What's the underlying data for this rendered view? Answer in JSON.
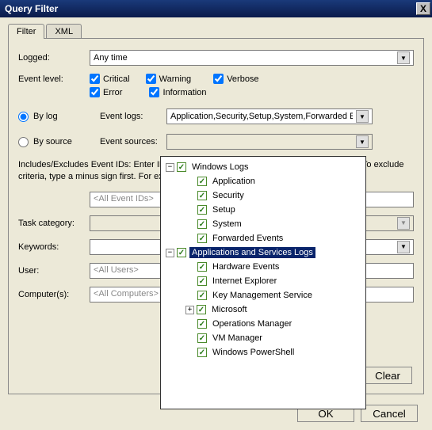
{
  "window": {
    "title": "Query Filter",
    "close": "X"
  },
  "tabs": {
    "filter": "Filter",
    "xml": "XML"
  },
  "labels": {
    "logged": "Logged:",
    "eventLevel": "Event level:",
    "byLog": "By log",
    "bySource": "By source",
    "eventLogs": "Event logs:",
    "eventSources": "Event sources:",
    "desc": "Includes/Excludes Event IDs: Enter ID numbers and/or ID ranges separated by commas. To exclude criteria, type a minus sign first. For example 1,3,5-99,-76",
    "taskCategory": "Task category:",
    "keywords": "Keywords:",
    "user": "User:",
    "computers": "Computer(s):"
  },
  "values": {
    "logged": "Any time",
    "eventLogs": "Application,Security,Setup,System,Forwarded Events",
    "eventSources": "",
    "eventIds": "<All Event IDs>",
    "users": "<All Users>",
    "computers": "<All Computers>"
  },
  "levels": {
    "critical": "Critical",
    "warning": "Warning",
    "verbose": "Verbose",
    "error": "Error",
    "information": "Information"
  },
  "buttons": {
    "clear": "Clear",
    "ok": "OK",
    "cancel": "Cancel"
  },
  "tree": {
    "root1": "Windows Logs",
    "r1c": [
      "Application",
      "Security",
      "Setup",
      "System",
      "Forwarded Events"
    ],
    "root2": "Applications and Services Logs",
    "r2c": [
      "Hardware Events",
      "Internet Explorer",
      "Key Management Service",
      "Microsoft",
      "Operations Manager",
      "VM Manager",
      "Windows PowerShell"
    ]
  }
}
